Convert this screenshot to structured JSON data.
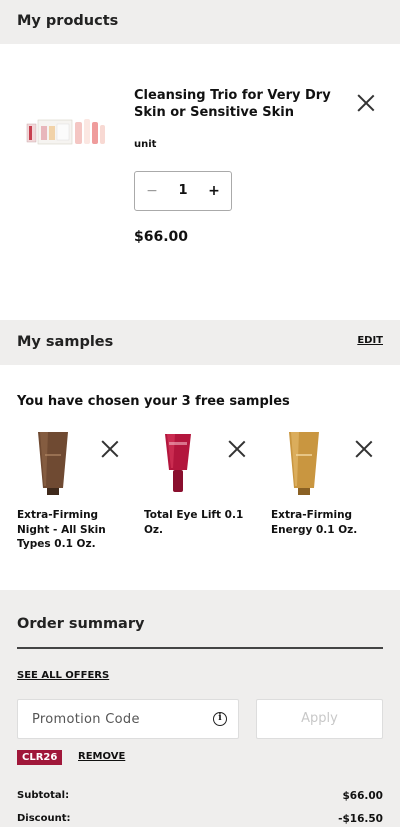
{
  "products": {
    "title": "My products",
    "item": {
      "name": "Cleansing Trio for Very Dry Skin or Sensitive Skin",
      "unit": "unit",
      "quantity": "1",
      "minus": "−",
      "plus": "+",
      "price": "$66.00"
    }
  },
  "samples": {
    "title": "My samples",
    "edit_label": "EDIT",
    "intro": "You have chosen your 3 free samples",
    "items": [
      {
        "name": "Extra-Firming Night - All Skin Types 0.1 Oz."
      },
      {
        "name": "Total Eye Lift 0.1 Oz."
      },
      {
        "name": "Extra-Firming Energy 0.1 Oz."
      }
    ]
  },
  "summary": {
    "title": "Order summary",
    "offers_link": "SEE ALL OFFERS",
    "promo_placeholder": "Promotion Code",
    "apply_label": "Apply",
    "applied_code": "CLR26",
    "remove_label": "REMOVE",
    "subtotal_label": "Subtotal:",
    "subtotal_value": "$66.00",
    "discount_label": "Discount:",
    "discount_value": "-$16.50"
  },
  "colors": {
    "section_bg": "#efeeed",
    "badge": "#a0173a"
  }
}
